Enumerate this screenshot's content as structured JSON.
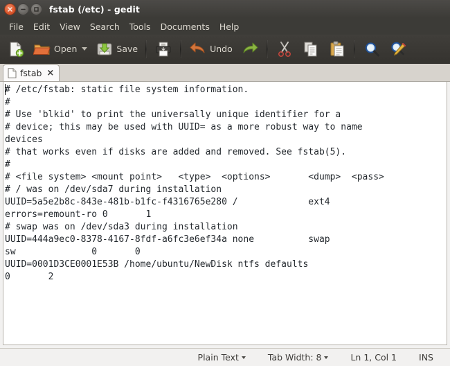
{
  "window": {
    "title": "fstab (/etc) - gedit",
    "controls": {
      "close": "close-button",
      "minimize": "minimize-button",
      "maximize": "maximize-button"
    }
  },
  "menubar": {
    "items": [
      {
        "label": "File"
      },
      {
        "label": "Edit"
      },
      {
        "label": "View"
      },
      {
        "label": "Search"
      },
      {
        "label": "Tools"
      },
      {
        "label": "Documents"
      },
      {
        "label": "Help"
      }
    ]
  },
  "toolbar": {
    "new_label": "",
    "open_label": "Open",
    "save_label": "Save",
    "print_label": "",
    "undo_label": "Undo",
    "redo_label": "",
    "cut_label": "",
    "copy_label": "",
    "paste_label": "",
    "find_label": "",
    "replace_label": ""
  },
  "tabs": [
    {
      "label": "fstab",
      "close": "×"
    }
  ],
  "editor": {
    "lines": [
      "# /etc/fstab: static file system information.",
      "#",
      "# Use 'blkid' to print the universally unique identifier for a",
      "# device; this may be used with UUID= as a more robust way to name",
      "devices",
      "# that works even if disks are added and removed. See fstab(5).",
      "#",
      "# <file system> <mount point>   <type>  <options>       <dump>  <pass>",
      "# / was on /dev/sda7 during installation",
      "UUID=5a5e2b8c-843e-481b-b1fc-f4316765e280 /             ext4",
      "errors=remount-ro 0       1",
      "# swap was on /dev/sda3 during installation",
      "UUID=444a9ec0-8378-4167-8fdf-a6fc3e6ef34a none          swap",
      "sw              0       0",
      "UUID=0001D3CE0001E53B /home/ubuntu/NewDisk ntfs defaults",
      "0       2"
    ]
  },
  "statusbar": {
    "language": "Plain Text",
    "tab_width": "Tab Width: 8",
    "position": "Ln 1, Col 1",
    "insert_mode": "INS"
  },
  "colors": {
    "titlebar_bg": "#3c3b37",
    "toolbar_bg": "#3a3834",
    "close_button": "#df5b30",
    "editor_bg": "#ffffff",
    "text": "#24292e",
    "statusbar_bg": "#f2f1f0"
  }
}
